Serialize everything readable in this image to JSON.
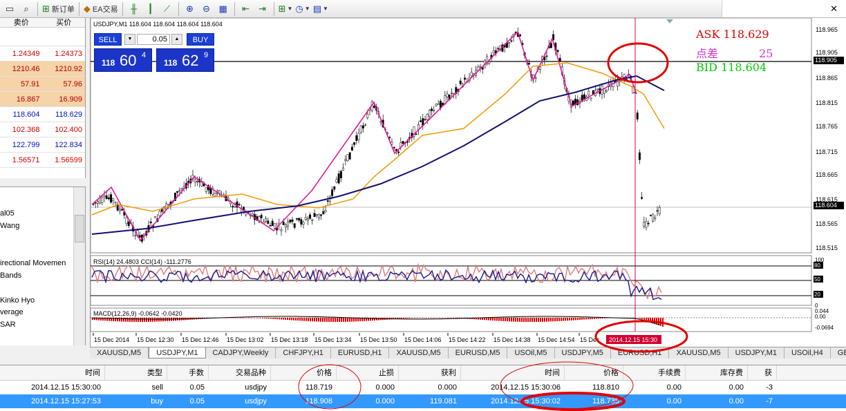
{
  "toolbar": {
    "new_order_label": "新订单",
    "ea_label": "EA交易"
  },
  "market_watch": {
    "col_bid": "卖价",
    "col_ask": "买价",
    "rows": [
      {
        "bid": "1.24349",
        "ask": "1.24373",
        "style": "red"
      },
      {
        "bid": "1210.46",
        "ask": "1210.92",
        "style": "hl"
      },
      {
        "bid": "57.91",
        "ask": "57.96",
        "style": "hl"
      },
      {
        "bid": "16.867",
        "ask": "16.909",
        "style": "hl"
      },
      {
        "bid": "118.604",
        "ask": "118.629",
        "style": "blue"
      },
      {
        "bid": "102.368",
        "ask": "102.400",
        "style": "red"
      },
      {
        "bid": "122.799",
        "ask": "122.834",
        "style": "blue"
      },
      {
        "bid": "1.56571",
        "ask": "1.56599",
        "style": "red"
      }
    ]
  },
  "navigator": {
    "items": [
      "al05",
      "Wang",
      "irectional Movemen",
      "Bands",
      "Kinko Hyo",
      "verage",
      "SAR"
    ]
  },
  "chart": {
    "title": "USDJPY,M1  118.604 118.604 118.604 118.604",
    "sell_label": "SELL",
    "buy_label": "BUY",
    "lot": "0.05",
    "sell_price": {
      "small": "118",
      "big": "60",
      "sup": "4"
    },
    "buy_price": {
      "small": "118",
      "big": "62",
      "sup": "9"
    },
    "ask_text": "ASK 118.629",
    "spread_label": "点差",
    "spread_value": "25",
    "bid_text": "BID 118.604",
    "price_scale": [
      "118.965",
      "118.905",
      "118.865",
      "118.815",
      "118.765",
      "118.715",
      "118.665",
      "118.615",
      "118.604",
      "118.565",
      "118.515"
    ],
    "hline_label": "118.905",
    "rsi_label": "RSI(14) 24.4803  CCI(14) -111.2776",
    "rsi_scale": [
      "100",
      "80",
      "50",
      "20",
      "0"
    ],
    "macd_label": "MACD(12,26,9) -0.0642 -0.0420",
    "macd_scale": [
      "0.044",
      "0.00",
      "-0.0694"
    ],
    "time_labels": [
      "15 Dec 2014",
      "15 Dec 12:30",
      "15 Dec 12:46",
      "15 Dec 13:02",
      "15 Dec 13:18",
      "15 Dec 13:34",
      "15 Dec 13:50",
      "15 Dec 14:06",
      "15 Dec 14:22",
      "15 Dec 14:38",
      "15 Dec 14:54",
      "15 Dec"
    ],
    "cursor_time": "2014.12.15 15:30"
  },
  "tabs": [
    "XAUUSD,M5",
    "USDJPY,M1",
    "CADJPY,Weekly",
    "CHFJPY,H1",
    "EURUSD,H1",
    "XAUUSD,M5",
    "EURUSD,M5",
    "USOil,M5",
    "USDJPY,M5",
    "EURUSD,H1",
    "XAUUSD,M5",
    "USDJPY,M1",
    "USOil,H4",
    "GBPU:"
  ],
  "terminal": {
    "headers": [
      "时间",
      "类型",
      "手数",
      "交易品种",
      "价格",
      "止损",
      "获利",
      "时间",
      "价格",
      "手续费",
      "库存费",
      "获"
    ],
    "rows": [
      [
        "2014.12.15 15:30:00",
        "sell",
        "0.05",
        "usdjpy",
        "118.719",
        "0.000",
        "0.000",
        "2014.12.15 15:30:06",
        "118.810",
        "0.00",
        "0.00",
        "-3"
      ],
      [
        "2014.12.15 15:27:53",
        "buy",
        "0.05",
        "usdjpy",
        "118.908",
        "0.000",
        "119.081",
        "2014.12.15 15:30:02",
        "118.735",
        "0.00",
        "0.00",
        "-7"
      ]
    ]
  },
  "colors": {
    "accent_blue": "#1c3fd6",
    "ask_red": "#e00000",
    "spread_magenta": "#cc33cc",
    "bid_green": "#00cc00",
    "selected_row": "#3399ff"
  }
}
